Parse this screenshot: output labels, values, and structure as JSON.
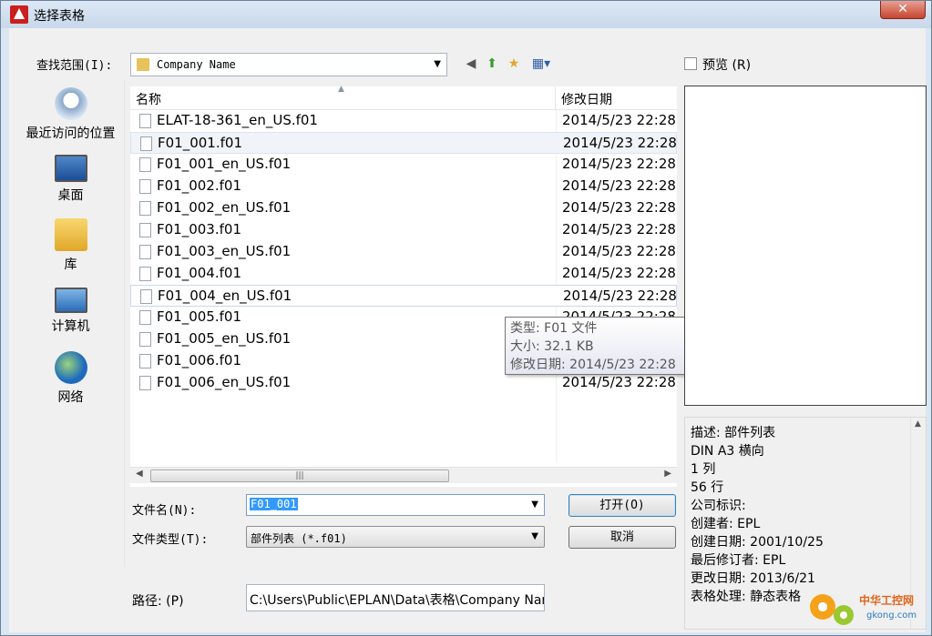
{
  "window": {
    "title": "选择表格",
    "close_glyph": "✕"
  },
  "toolbar": {
    "look_in_label": "查找范围(I):",
    "look_in_value": "Company Name",
    "back_glyph": "◀",
    "up_glyph": "⬆",
    "newfolder_glyph": "★",
    "views_glyph": "▦▾"
  },
  "preview": {
    "checkbox_label": "预览 (R)",
    "checked": false
  },
  "places": [
    {
      "label": "最近访问的位置",
      "icon": "recent-places-icon"
    },
    {
      "label": "桌面",
      "icon": "desktop-icon"
    },
    {
      "label": "库",
      "icon": "library-icon"
    },
    {
      "label": "计算机",
      "icon": "computer-icon"
    },
    {
      "label": "网络",
      "icon": "network-icon"
    }
  ],
  "file_list": {
    "columns": [
      "名称",
      "修改日期"
    ],
    "rows": [
      {
        "name": "ELAT-18-361_en_US.f01",
        "date": "2014/5/23 22:28"
      },
      {
        "name": "F01_001.f01",
        "date": "2014/5/23 22:28"
      },
      {
        "name": "F01_001_en_US.f01",
        "date": "2014/5/23 22:28"
      },
      {
        "name": "F01_002.f01",
        "date": "2014/5/23 22:28"
      },
      {
        "name": "F01_002_en_US.f01",
        "date": "2014/5/23 22:28"
      },
      {
        "name": "F01_003.f01",
        "date": "2014/5/23 22:28"
      },
      {
        "name": "F01_003_en_US.f01",
        "date": "2014/5/23 22:28"
      },
      {
        "name": "F01_004.f01",
        "date": "2014/5/23 22:28"
      },
      {
        "name": "F01_004_en_US.f01",
        "date": "2014/5/23 22:28"
      },
      {
        "name": "F01_005.f01",
        "date": "2014/5/23 22:28"
      },
      {
        "name": "F01_005_en_US.f01",
        "date": ""
      },
      {
        "name": "F01_006.f01",
        "date": ""
      },
      {
        "name": "F01_006_en_US.f01",
        "date": "2014/5/23 22:28"
      }
    ],
    "selected_index": 1,
    "hover_index": 8
  },
  "tooltip": {
    "type": "类型: F01 文件",
    "size": "大小: 32.1 KB",
    "modified": "修改日期: 2014/5/23 22:28"
  },
  "form": {
    "filename_label": "文件名(N):",
    "filename_value": "F01_001",
    "filetype_label": "文件类型(T):",
    "filetype_value": "部件列表 (*.f01)",
    "open_label": "打开(O)",
    "cancel_label": "取消",
    "path_label": "路径: (P)",
    "path_value": "C:\\Users\\Public\\EPLAN\\Data\\表格\\Company Nam"
  },
  "description": {
    "lines": [
      "描述: 部件列表",
      "DIN A3 横向",
      "1 列",
      "56 行",
      "公司标识:",
      "创建者: EPL",
      "创建日期: 2001/10/25",
      "最后修订者: EPL",
      "更改日期: 2013/6/21",
      "表格处理: 静态表格"
    ]
  },
  "watermark": {
    "brand": "中华工控网",
    "domain": "gkong.com"
  },
  "colors": {
    "selection": "#3399ff",
    "title_icon": "#c8201e",
    "close_button": "#c7452e"
  }
}
